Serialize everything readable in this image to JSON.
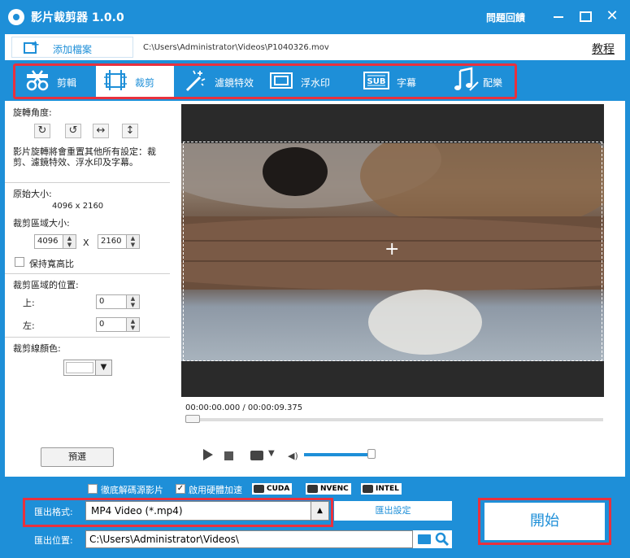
{
  "app": {
    "title": "影片裁剪器 1.0.0",
    "feedback": "問題回饋"
  },
  "filebar": {
    "add_file": "添加檔案",
    "path": "C:\\Users\\Administrator\\Videos\\P1040326.mov",
    "tutorial": "教程"
  },
  "tabs": [
    {
      "label": "剪輯",
      "icon": "scissors-film-icon"
    },
    {
      "label": "裁剪",
      "icon": "crop-icon"
    },
    {
      "label": "濾鏡特效",
      "icon": "magic-wand-icon"
    },
    {
      "label": "浮水印",
      "icon": "watermark-icon"
    },
    {
      "label": "字幕",
      "icon": "subtitle-icon"
    },
    {
      "label": "配樂",
      "icon": "music-icon"
    }
  ],
  "left_panel": {
    "rotate_label": "旋轉角度:",
    "rotate_note": "影片旋轉將會重置其他所有設定：裁剪、濾鏡特效、浮水印及字幕。",
    "original_size_label": "原始大小:",
    "original_size": "4096 x 2160",
    "crop_size_label": "裁剪區域大小:",
    "crop_width": "4096",
    "crop_x": "X",
    "crop_height": "2160",
    "keep_ratio": "保持寬高比",
    "position_label": "裁剪區域的位置:",
    "top_label": "上:",
    "top_value": "0",
    "left_label": "左:",
    "left_value": "0",
    "line_color_label": "裁剪線顏色:",
    "preview_button": "預選"
  },
  "player": {
    "timecode": "00:00:00.000 / 00:00:09.375"
  },
  "bottom": {
    "full_decode": "徹底解碼源影片",
    "hw_accel": "啟用硬體加速",
    "badges": [
      "CUDA",
      "NVENC",
      "INTEL"
    ],
    "format_label": "匯出格式:",
    "format_value": "MP4 Video (*.mp4)",
    "export_settings": "匯出設定",
    "location_label": "匯出位置:",
    "location_value": "C:\\Users\\Administrator\\Videos\\",
    "start_button": "開始"
  },
  "colors": {
    "accent": "#1e8fd8",
    "highlight": "#e8313e"
  }
}
